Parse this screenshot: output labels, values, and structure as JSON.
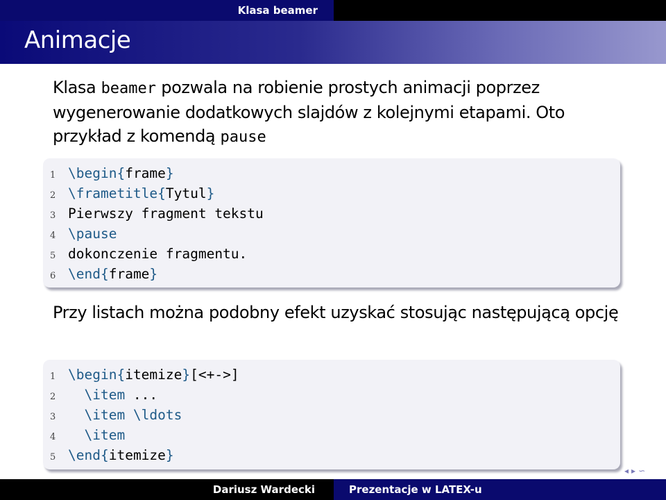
{
  "header": {
    "section_title": "Klasa beamer",
    "frame_title": "Animacje"
  },
  "body": {
    "paragraph1": {
      "part1": "Klasa ",
      "code1": "beamer",
      "part2": " pozwala na robienie prostych animacji poprzez wygenerowanie dodatkowych slajdów z kolejnymi etapami. Oto przykład z komendą ",
      "code2": "pause"
    },
    "code_block1": [
      {
        "num": "1",
        "cmd": "\\begin",
        "brace_open": "{",
        "arg": "frame",
        "brace_close": "}",
        "rest": ""
      },
      {
        "num": "2",
        "cmd": "\\frametitle",
        "brace_open": "{",
        "arg": "Tytul",
        "brace_close": "}",
        "rest": ""
      },
      {
        "num": "3",
        "cmd": "",
        "brace_open": "",
        "arg": "",
        "brace_close": "",
        "rest": "Pierwszy fragment tekstu"
      },
      {
        "num": "4",
        "cmd": "\\pause",
        "brace_open": "",
        "arg": "",
        "brace_close": "",
        "rest": ""
      },
      {
        "num": "5",
        "cmd": "",
        "brace_open": "",
        "arg": "",
        "brace_close": "",
        "rest": "dokonczenie fragmentu."
      },
      {
        "num": "6",
        "cmd": "\\end",
        "brace_open": "{",
        "arg": "frame",
        "brace_close": "}",
        "rest": ""
      }
    ],
    "paragraph2": "Przy listach można podobny efekt uzyskać stosując następującą opcję",
    "code_block2": [
      {
        "num": "1",
        "indent": "",
        "cmd": "\\begin",
        "brace_open": "{",
        "arg": "itemize",
        "brace_close": "}",
        "rest": "[<+->]"
      },
      {
        "num": "2",
        "indent": "  ",
        "cmd": "\\item",
        "brace_open": "",
        "arg": "",
        "brace_close": "",
        "rest": " ..."
      },
      {
        "num": "3",
        "indent": "  ",
        "cmd": "\\item \\ldots",
        "brace_open": "",
        "arg": "",
        "brace_close": "",
        "rest": ""
      },
      {
        "num": "4",
        "indent": "  ",
        "cmd": "\\item",
        "brace_open": "",
        "arg": "",
        "brace_close": "",
        "rest": ""
      },
      {
        "num": "5",
        "indent": "",
        "cmd": "\\end",
        "brace_open": "{",
        "arg": "itemize",
        "brace_close": "}",
        "rest": ""
      }
    ]
  },
  "footer": {
    "author": "Dariusz Wardecki",
    "talk_title": "Prezentacje w LATEX-u"
  },
  "navigation": {
    "symbols": [
      "left-arrow-icon",
      "right-arrow-icon",
      "search-icon"
    ]
  },
  "colors": {
    "header_dark": "#0a0a6e",
    "keyword": "#1e5a88",
    "code_bg": "#f2f2f7"
  }
}
